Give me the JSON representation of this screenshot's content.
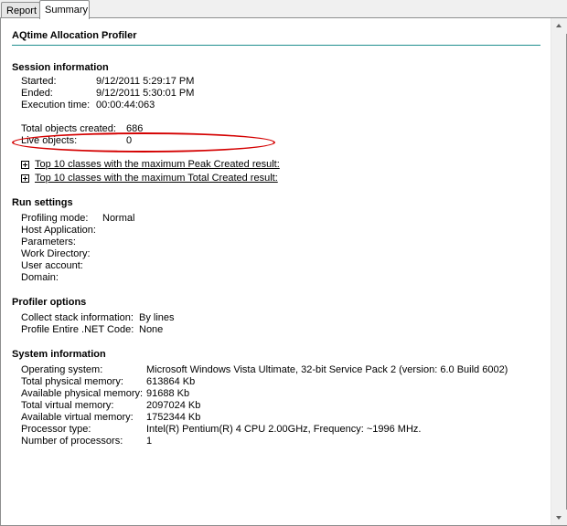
{
  "tabs": [
    {
      "label": "Report"
    },
    {
      "label": "Summary"
    }
  ],
  "title": "AQtime Allocation Profiler",
  "session": {
    "heading": "Session information",
    "started_label": "Started:",
    "started": "9/12/2011 5:29:17 PM",
    "ended_label": "Ended:",
    "ended": "9/12/2011 5:30:01 PM",
    "exec_label": "Execution time:",
    "exec": "00:00:44:063",
    "total_label": "Total objects created:",
    "total": "686",
    "live_label": "Live objects:",
    "live": "0",
    "link1": "Top 10 classes with the maximum Peak Created result:",
    "link2": "Top 10 classes with the maximum Total Created result:"
  },
  "run": {
    "heading": "Run settings",
    "mode_label": "Profiling mode:",
    "mode": "Normal",
    "host_label": "Host Application:",
    "params_label": "Parameters:",
    "workdir_label": "Work Directory:",
    "user_label": "User account:",
    "domain_label": "Domain:"
  },
  "profiler": {
    "heading": "Profiler options",
    "stack_label": "Collect stack information:",
    "stack": "By lines",
    "net_label": "Profile Entire .NET Code:",
    "net": "None"
  },
  "system": {
    "heading": "System information",
    "os_label": "Operating system:",
    "os": "Microsoft Windows Vista Ultimate, 32-bit Service Pack 2 (version: 6.0 Build 6002)",
    "tpm_label": "Total physical memory:",
    "tpm": "613864 Kb",
    "apm_label": "Available physical memory:",
    "apm": "91688 Kb",
    "tvm_label": "Total virtual memory:",
    "tvm": "2097024 Kb",
    "avm_label": "Available virtual memory:",
    "avm": "1752344 Kb",
    "cpu_label": "Processor type:",
    "cpu": "Intel(R) Pentium(R) 4 CPU 2.00GHz, Frequency: ~1996 MHz.",
    "nproc_label": "Number of processors:",
    "nproc": "1"
  },
  "colors": {
    "accent_rule": "#1f8f8f",
    "highlight": "#d40000"
  }
}
